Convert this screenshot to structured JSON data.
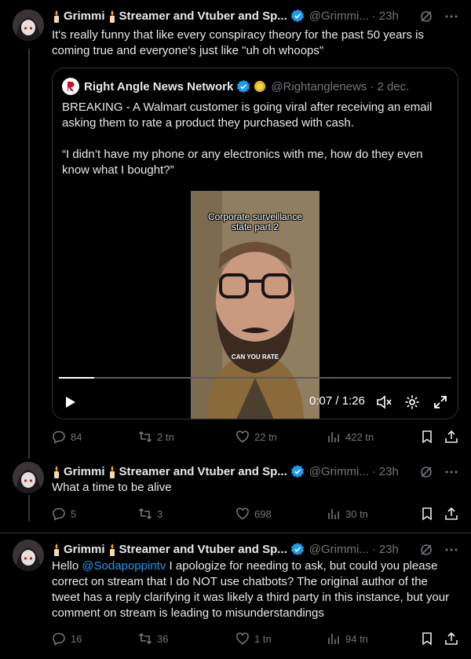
{
  "tweets": [
    {
      "display_name": "Grimmi",
      "display_name_rest": "Streamer and Vtuber and Sp...",
      "handle": "@Grimmi...",
      "time": "23h",
      "text": "It's really funny that like every conspiracy theory for the past 50 years is coming true and everyone's just like \"uh oh whoops\"",
      "stats": {
        "replies": "84",
        "reposts": "2 tn",
        "likes": "22 tn",
        "views": "422 tn"
      }
    },
    {
      "display_name": "Grimmi",
      "display_name_rest": "Streamer and Vtuber and Sp...",
      "handle": "@Grimmi...",
      "time": "23h",
      "text": "What a time to be alive",
      "stats": {
        "replies": "5",
        "reposts": "3",
        "likes": "698",
        "views": "30 tn"
      }
    },
    {
      "display_name": "Grimmi",
      "display_name_rest": "Streamer and Vtuber and Sp...",
      "handle": "@Grimmi...",
      "time": "23h",
      "text_before": "Hello ",
      "mention": "@Sodapoppintv",
      "text_after": " I apologize for needing to ask, but could you please correct on stream that I do NOT use chatbots? The original author of the tweet has a reply clarifying it was likely a third party in this instance, but your comment on stream is leading to misunderstandings",
      "stats": {
        "replies": "16",
        "reposts": "36",
        "likes": "1 tn",
        "views": "94 tn"
      }
    }
  ],
  "quote": {
    "name": "Right Angle News Network",
    "handle": "@Rightanglenews",
    "date": "· 2 dec.",
    "text1": "BREAKING - A Walmart customer is going viral after receiving an email asking them to rate a product they purchased with cash.",
    "text2": "“I didn’t have my phone or any electronics with me, how do they even know what I bought?”",
    "video": {
      "caption": "Corporate surveillance state part 2",
      "subtitle": "CAN YOU RATE",
      "time": "0:07 / 1:26",
      "progress": 0.09
    }
  },
  "colors": {
    "accent": "#1d9bf0",
    "muted": "#71767b",
    "verified": "#1d9bf0",
    "gold": "#e2b719"
  }
}
